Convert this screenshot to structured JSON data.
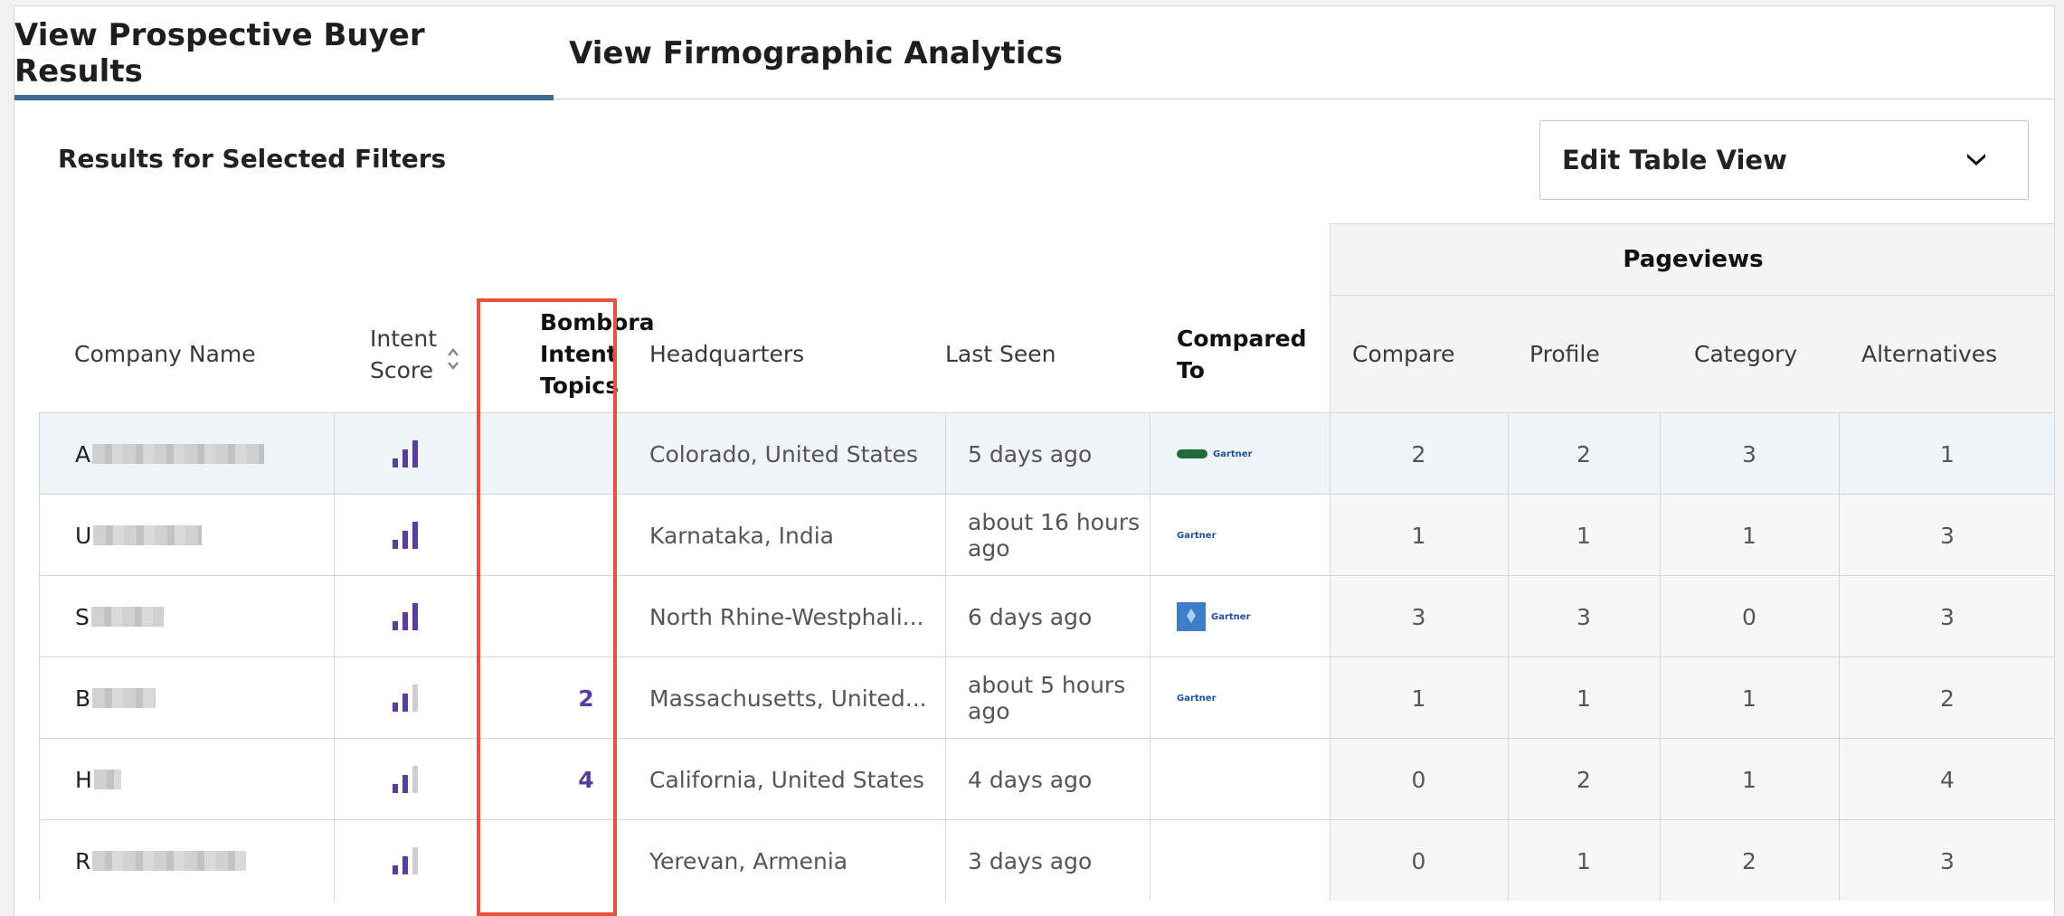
{
  "tabs": [
    {
      "label": "View Prospective Buyer Results",
      "active": true
    },
    {
      "label": "View Firmographic Analytics",
      "active": false
    }
  ],
  "results_title": "Results for Selected Filters",
  "edit_view": {
    "label": "Edit Table View"
  },
  "table": {
    "group_header": "Pageviews",
    "headers": {
      "company": "Company Name",
      "intent_line1": "Intent",
      "intent_line2": "Score",
      "bombora_line1": "Bombora",
      "bombora_line2": "Intent",
      "bombora_line3": "Topics",
      "hq": "Headquarters",
      "last_seen": "Last Seen",
      "compared_to": "Compared To",
      "compare": "Compare",
      "profile": "Profile",
      "category": "Category",
      "alternatives": "Alternatives"
    },
    "rows": [
      {
        "initial": "A",
        "intent_level": 3,
        "topics": "",
        "hq": "Colorado, United States",
        "last_seen": "5 days ago",
        "compared_logo": "green",
        "compare": "2",
        "profile": "2",
        "category": "3",
        "alternatives": "1"
      },
      {
        "initial": "U",
        "intent_level": 3,
        "topics": "",
        "hq": "Karnataka, India",
        "last_seen": "about 16 hours ago",
        "compared_logo": "none",
        "compare": "1",
        "profile": "1",
        "category": "1",
        "alternatives": "3"
      },
      {
        "initial": "S",
        "intent_level": 3,
        "topics": "",
        "hq": "North Rhine-Westphali...",
        "last_seen": "6 days ago",
        "compared_logo": "blue",
        "compare": "3",
        "profile": "3",
        "category": "0",
        "alternatives": "3"
      },
      {
        "initial": "B",
        "intent_level": 2,
        "topics": "2",
        "hq": "Massachusetts, United...",
        "last_seen": "about 5 hours ago",
        "compared_logo": "none",
        "compare": "1",
        "profile": "1",
        "category": "1",
        "alternatives": "2"
      },
      {
        "initial": "H",
        "intent_level": 2,
        "topics": "4",
        "hq": "California, United States",
        "last_seen": "4 days ago",
        "compared_logo": "empty",
        "compare": "0",
        "profile": "2",
        "category": "1",
        "alternatives": "4"
      },
      {
        "initial": "R",
        "intent_level": 2,
        "topics": "",
        "hq": "Yerevan, Armenia",
        "last_seen": "3 days ago",
        "compared_logo": "empty",
        "compare": "0",
        "profile": "1",
        "category": "2",
        "alternatives": "3"
      }
    ]
  },
  "compared_logo_text": "Gartner",
  "colors": {
    "accent": "#3e6a8c",
    "intent_bar": "#5b3d99",
    "highlight": "#e5533a"
  }
}
